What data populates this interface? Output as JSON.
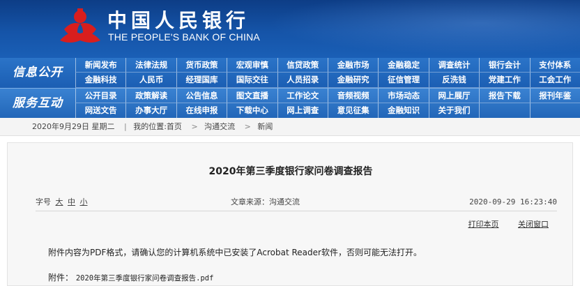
{
  "header": {
    "logo_cn": "中国人民银行",
    "logo_en": "THE PEOPLE'S BANK OF CHINA",
    "logo_icon": "pboc-emblem-icon",
    "colors": {
      "header_blue": "#0d3d86",
      "nav_blue": "#1b5eb3",
      "emblem_red": "#d81e1e"
    }
  },
  "nav": {
    "section1_label": "信息公开",
    "section2_label": "服务互动",
    "row1": [
      "新闻发布",
      "法律法规",
      "货币政策",
      "宏观审慎",
      "信贷政策",
      "金融市场",
      "金融稳定",
      "调查统计",
      "银行会计",
      "支付体系"
    ],
    "row2": [
      "金融科技",
      "人民币",
      "经理国库",
      "国际交往",
      "人员招录",
      "金融研究",
      "征信管理",
      "反洗钱",
      "党建工作",
      "工会工作"
    ],
    "row3": [
      "公开目录",
      "政策解读",
      "公告信息",
      "图文直播",
      "工作论文",
      "音频视频",
      "市场动态",
      "网上展厅",
      "报告下载",
      "报刊年鉴"
    ],
    "row4": [
      "网送文告",
      "办事大厅",
      "在线申报",
      "下载中心",
      "网上调查",
      "意见征集",
      "金融知识",
      "关于我们",
      "",
      ""
    ]
  },
  "breadcrumb": {
    "date": "2020年9月29日 星期二",
    "location_label": "我的位置:首页",
    "level1": "沟通交流",
    "level2": "新闻"
  },
  "article": {
    "title": "2020年第三季度银行家问卷调查报告",
    "font_size_label": "字号",
    "font_large": "大",
    "font_medium": "中",
    "font_small": "小",
    "source": "文章来源：沟通交流",
    "timestamp": "2020-09-29  16:23:40",
    "print_label": "打印本页",
    "close_label": "关闭窗口",
    "notice": "附件内容为PDF格式，请确认您的计算机系统中已安装了Acrobat Reader软件，否则可能无法打开。",
    "attachment_label": "附件：",
    "attachment_file": "2020年第三季度银行家问卷调查报告.pdf"
  }
}
